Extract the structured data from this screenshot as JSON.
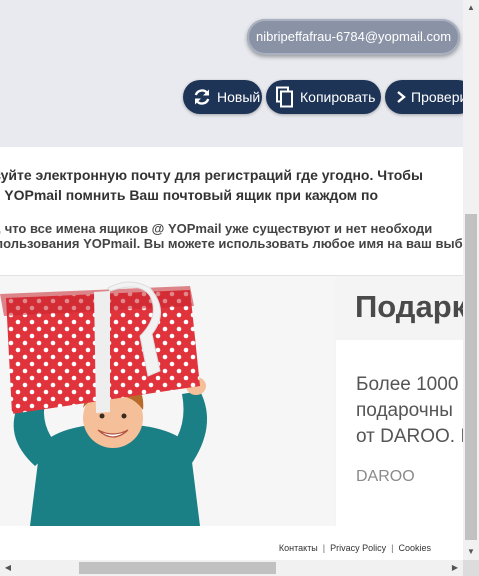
{
  "header": {
    "email": "nibripeffafrau-6784@yopmail.com",
    "buttons": {
      "new_label": "Новый",
      "copy_label": "Копировать",
      "check_label": "Проверить"
    }
  },
  "info": {
    "line1": "Используйте электронную почту для регистраций где угодно. Чтобы",
    "line2": "позволить YOPmail помнить Ваш почтовый ящик при каждом по",
    "line3": "Обратите внимание, что все имена ящиков @ YOPmail уже существуют и нет необходи",
    "line4": "использования YOPmail. Вы можете использовать любое имя на ваш выбор"
  },
  "ad": {
    "title": "Подарк",
    "body_lines": [
      "Более 1000",
      "подарочны",
      "от DAROO. I"
    ],
    "brand": "DAROO"
  },
  "footer": {
    "links": [
      "Контакты",
      "Privacy Policy",
      "Cookies"
    ],
    "separator": "|"
  },
  "colors": {
    "accent": "#1e3457",
    "email_pill": "#8a93a6",
    "header_bg": "#e8eaef",
    "gift_red": "#e0333c"
  },
  "icons": {
    "new": "refresh-icon",
    "copy": "copy-icon",
    "check": "chevron-right-icon"
  }
}
